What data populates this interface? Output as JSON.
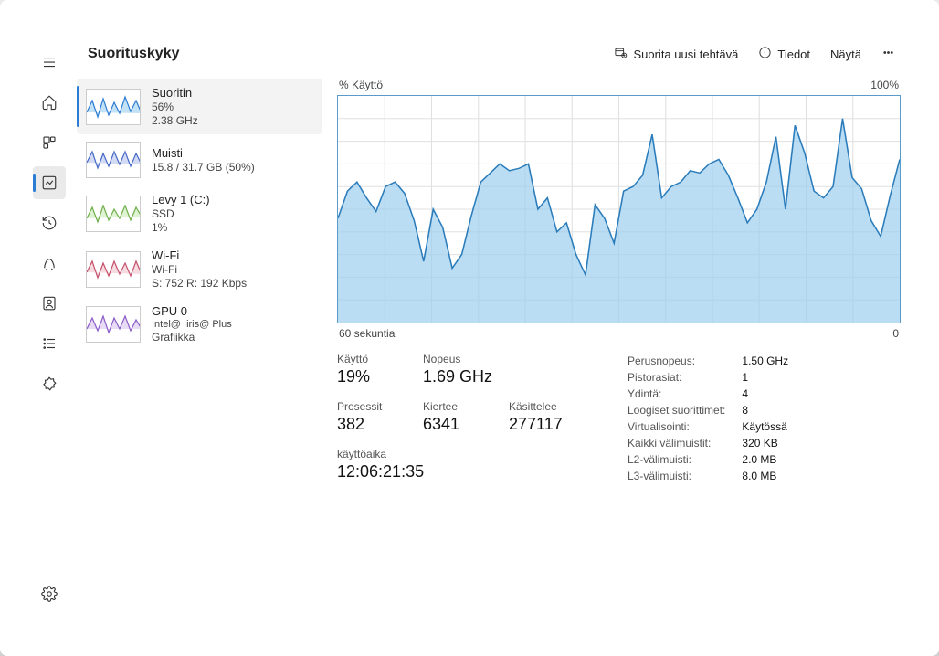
{
  "header": {
    "title": "Suorituskyky",
    "run_task": "Suorita uusi tehtävä",
    "details": "Tiedot",
    "view": "Näytä"
  },
  "sidebar": {
    "items": [
      {
        "title": "Suoritin",
        "line1": "56%",
        "line2": "2.38 GHz"
      },
      {
        "title": "Muisti",
        "line1": "15.8 / 31.7 GB (50%)",
        "line2": ""
      },
      {
        "title": "Levy 1 (C:)",
        "line1": "SSD",
        "line2": "1%"
      },
      {
        "title": "Wi-Fi",
        "line1": "Wi-Fi",
        "line2": "S: 752 R: 192 Kbps"
      },
      {
        "title": "GPU 0",
        "line1": "Intel@   Iiris@   Plus",
        "line2": "Grafiikka"
      }
    ]
  },
  "chart": {
    "y_label": "% Käyttö",
    "y_max": "100%",
    "x_label": "60 sekuntia",
    "x_max": "0"
  },
  "stats": {
    "usage_label": "Käyttö",
    "usage_value": "19%",
    "speed_label": "Nopeus",
    "speed_value": "1.69 GHz",
    "processes_label": "Prosessit",
    "processes_value": "382",
    "threads_label": "Kiertee",
    "threads_value": "6341",
    "handles_label": "Käsittelee",
    "handles_value": "277117",
    "uptime_label": "käyttöaika",
    "uptime_value": "12:06:21:35",
    "spec": [
      {
        "label": "Perusnopeus:",
        "value": "1.50 GHz"
      },
      {
        "label": "Pistorasiat:",
        "value": "1"
      },
      {
        "label": "Ydintä:",
        "value": "4"
      },
      {
        "label": "Loogiset suorittimet:",
        "value": "8"
      },
      {
        "label": "Virtualisointi:",
        "value": "Käytössä"
      },
      {
        "label": "Kaikki välimuistit:",
        "value": "320 KB"
      },
      {
        "label": "L2-välimuisti:",
        "value": "2.0 MB"
      },
      {
        "label": "L3-välimuisti:",
        "value": "8.0 MB"
      }
    ]
  },
  "chart_data": {
    "type": "area",
    "title": "% Käyttö",
    "x": [
      0,
      1,
      2,
      3,
      4,
      5,
      6,
      7,
      8,
      9,
      10,
      11,
      12,
      13,
      14,
      15,
      16,
      17,
      18,
      19,
      20,
      21,
      22,
      23,
      24,
      25,
      26,
      27,
      28,
      29,
      30,
      31,
      32,
      33,
      34,
      35,
      36,
      37,
      38,
      39,
      40,
      41,
      42,
      43,
      44,
      45,
      46,
      47,
      48,
      49,
      50,
      51,
      52,
      53,
      54,
      55,
      56,
      57,
      58,
      59
    ],
    "values": [
      46,
      58,
      62,
      55,
      49,
      60,
      62,
      57,
      45,
      27,
      50,
      42,
      24,
      30,
      47,
      62,
      66,
      70,
      67,
      68,
      70,
      50,
      55,
      40,
      44,
      30,
      21,
      52,
      46,
      35,
      58,
      60,
      65,
      83,
      55,
      60,
      62,
      67,
      66,
      70,
      72,
      65,
      55,
      44,
      50,
      62,
      82,
      50,
      87,
      75,
      58,
      55,
      60,
      90,
      64,
      59,
      45,
      38,
      56,
      72
    ],
    "xlabel": "60 sekuntia",
    "ylabel": "% Käyttö",
    "ylim": [
      0,
      100
    ]
  }
}
